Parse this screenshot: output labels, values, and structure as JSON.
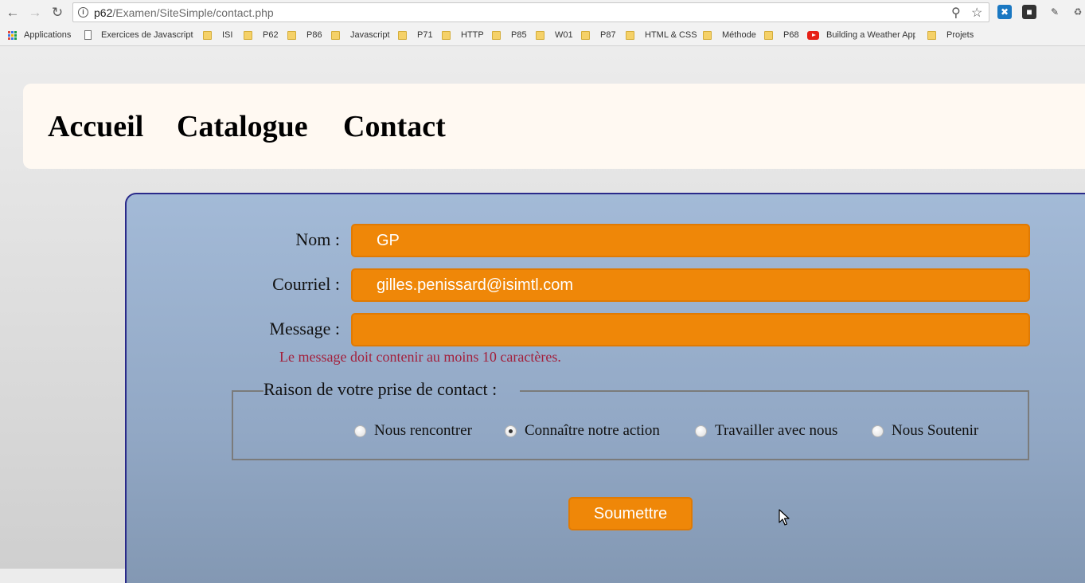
{
  "browser": {
    "url_host": "p62",
    "url_path": "/Examen/SiteSimple/contact.php",
    "bookmarks": [
      {
        "label": "Applications",
        "icon": "apps-icon"
      },
      {
        "label": "Exercices de Javascript",
        "icon": "page-icon"
      },
      {
        "label": "ISI",
        "icon": "folder-icon"
      },
      {
        "label": "P62",
        "icon": "folder-icon"
      },
      {
        "label": "P86",
        "icon": "folder-icon"
      },
      {
        "label": "Javascript",
        "icon": "folder-icon"
      },
      {
        "label": "P71",
        "icon": "folder-icon"
      },
      {
        "label": "HTTP",
        "icon": "folder-icon"
      },
      {
        "label": "P85",
        "icon": "folder-icon"
      },
      {
        "label": "W01",
        "icon": "folder-icon"
      },
      {
        "label": "P87",
        "icon": "folder-icon"
      },
      {
        "label": "HTML & CSS",
        "icon": "folder-icon"
      },
      {
        "label": "Méthode",
        "icon": "folder-icon"
      },
      {
        "label": "P68",
        "icon": "folder-icon"
      },
      {
        "label": "Building a Weather App",
        "icon": "youtube-icon"
      },
      {
        "label": "Projets",
        "icon": "folder-icon"
      }
    ]
  },
  "nav": {
    "items": [
      {
        "label": "Accueil"
      },
      {
        "label": "Catalogue"
      },
      {
        "label": "Contact"
      }
    ]
  },
  "form": {
    "name_label": "Nom :",
    "name_value": "GP",
    "email_label": "Courriel :",
    "email_value": "gilles.penissard@isimtl.com",
    "message_label": "Message :",
    "message_value": "",
    "error_text": "Le message doit contenir au moins 10 caractères.",
    "reason_legend": "Raison de votre prise de contact :",
    "reasons": [
      {
        "label": "Nous rencontrer",
        "checked": false
      },
      {
        "label": "Connaître notre action",
        "checked": true
      },
      {
        "label": "Travailler avec nous",
        "checked": false
      },
      {
        "label": "Nous Soutenir",
        "checked": false
      }
    ],
    "submit_label": "Soumettre"
  },
  "colors": {
    "accent": "#ef8708",
    "panel": "#9db3d0",
    "error": "#a3203c",
    "header_bg": "#fff9f2"
  }
}
